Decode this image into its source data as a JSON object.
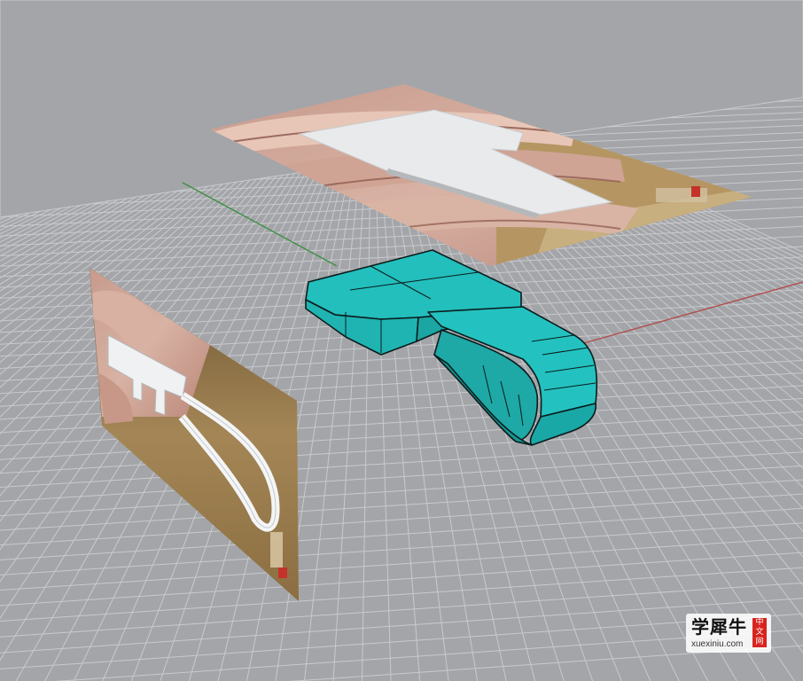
{
  "viewport": {
    "view": "perspective",
    "grid_visible": true,
    "colors": {
      "background": "#a3a5a9",
      "grid_line": "#c8cacd",
      "x_axis": "#b0504c",
      "y_axis": "#3f8f45",
      "model_fill": "#22bfbd",
      "model_edge": "#0b1c1c"
    }
  },
  "reference_images": [
    {
      "name": "top-reference-photo",
      "subject": "white clip held between fingers"
    },
    {
      "name": "side-reference-photo",
      "subject": "white clip loop on wooden table"
    }
  ],
  "model": {
    "name": "clip-3d-model",
    "color": "#22bfbd"
  },
  "watermark": {
    "logo_text": "学犀牛",
    "site": "xuexiniu.com",
    "seal_chars": [
      "中",
      "文",
      "网"
    ]
  }
}
